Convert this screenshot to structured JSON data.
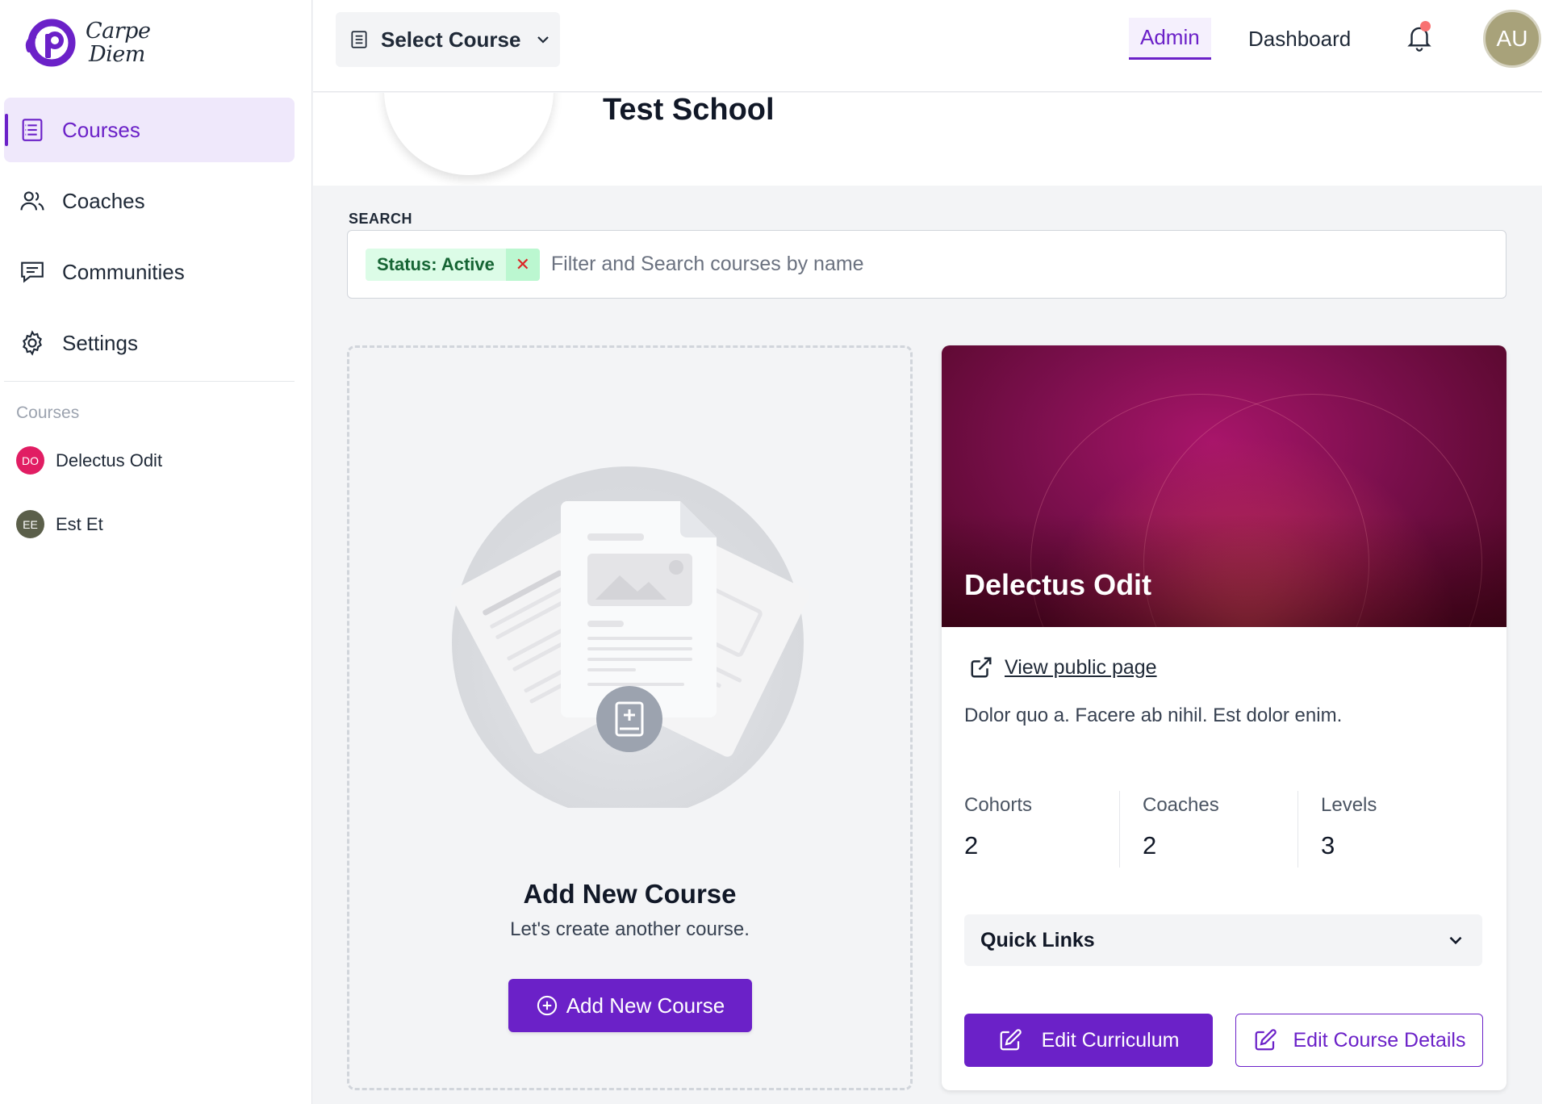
{
  "brand": {
    "name_line1": "Carpe",
    "name_line2": "Diem",
    "color": "#6b21c8"
  },
  "sidebar": {
    "items": [
      {
        "label": "Courses",
        "icon": "courses-icon",
        "active": true
      },
      {
        "label": "Coaches",
        "icon": "users-icon",
        "active": false
      },
      {
        "label": "Communities",
        "icon": "chat-icon",
        "active": false
      },
      {
        "label": "Settings",
        "icon": "gear-icon",
        "active": false
      }
    ],
    "section_title": "Courses",
    "courses": [
      {
        "initials": "DO",
        "name": "Delectus Odit",
        "color": "#e11d63"
      },
      {
        "initials": "EE",
        "name": "Est Et",
        "color": "#5b5f4a"
      }
    ]
  },
  "topbar": {
    "select_course": "Select Course",
    "admin": "Admin",
    "dashboard": "Dashboard",
    "avatar_initials": "AU"
  },
  "school": {
    "name": "Test School"
  },
  "search": {
    "label": "SEARCH",
    "chip": "Status: Active",
    "chip_remove": "✕",
    "placeholder": "Filter and Search courses by name"
  },
  "add_course": {
    "title": "Add New Course",
    "subtitle": "Let's create another course.",
    "button": "Add New Course"
  },
  "course_card": {
    "title": "Delectus Odit",
    "view_public": "View public page",
    "description": "Dolor quo a. Facere ab nihil. Est dolor enim.",
    "stats": [
      {
        "label": "Cohorts",
        "value": "2"
      },
      {
        "label": "Coaches",
        "value": "2"
      },
      {
        "label": "Levels",
        "value": "3"
      }
    ],
    "quick_links": "Quick Links",
    "edit_curriculum": "Edit Curriculum",
    "edit_details": "Edit Course Details"
  }
}
